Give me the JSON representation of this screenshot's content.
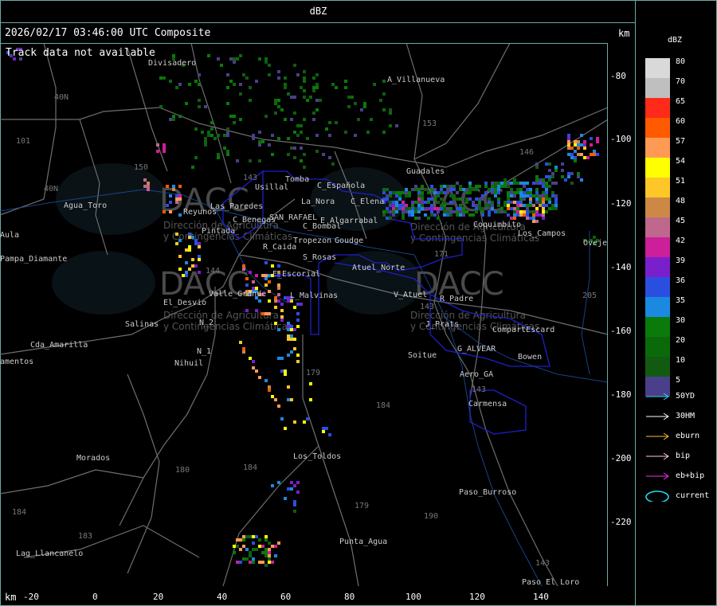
{
  "header": {
    "title": "dBZ"
  },
  "overlay": {
    "timestamp": "2026/02/17 03:46:00 UTC Composite",
    "track_status": "Track data not available",
    "unit_top": "km",
    "unit_bottom": "km"
  },
  "axes": {
    "y_ticks": [
      "-80",
      "-100",
      "-120",
      "-140",
      "-160",
      "-180",
      "-200",
      "-220"
    ],
    "x_ticks": [
      "-20",
      "0",
      "20",
      "40",
      "60",
      "80",
      "100",
      "120",
      "140"
    ]
  },
  "legend": {
    "title": "dBZ",
    "levels": [
      {
        "label": "80",
        "color": "#d9d9d9"
      },
      {
        "label": "70",
        "color": "#bfbfbf"
      },
      {
        "label": "65",
        "color": "#ff2a1a"
      },
      {
        "label": "60",
        "color": "#ff5a00"
      },
      {
        "label": "57",
        "color": "#ff9a55"
      },
      {
        "label": "54",
        "color": "#ffff00"
      },
      {
        "label": "51",
        "color": "#ffc628"
      },
      {
        "label": "48",
        "color": "#cc8844"
      },
      {
        "label": "45",
        "color": "#c0678d"
      },
      {
        "label": "42",
        "color": "#cc1f99"
      },
      {
        "label": "39",
        "color": "#7a1fcc"
      },
      {
        "label": "36",
        "color": "#2a4fe0"
      },
      {
        "label": "35",
        "color": "#1a8ae0"
      },
      {
        "label": "30",
        "color": "#0a7a0a"
      },
      {
        "label": "20",
        "color": "#0a6a0a"
      },
      {
        "label": "10",
        "color": "#125a12"
      },
      {
        "label": "5",
        "color": "#4a3f8a"
      }
    ],
    "tracks": [
      {
        "label": "50YD",
        "color": "#22ddee"
      },
      {
        "label": "30HM",
        "color": "#ffffff"
      },
      {
        "label": "eburn",
        "color": "#ffbb33"
      },
      {
        "label": "bip",
        "color": "#ffccdd"
      },
      {
        "label": "eb+bip",
        "color": "#ee33ee"
      },
      {
        "label": "current",
        "color": "#22ddee"
      }
    ]
  },
  "map": {
    "place_labels": [
      {
        "text": "Divisadero"
      },
      {
        "text": "A_Villanueva"
      },
      {
        "text": "Guadales"
      },
      {
        "text": "Usillal"
      },
      {
        "text": "Tomba"
      },
      {
        "text": "C_Española"
      },
      {
        "text": "La_Nora"
      },
      {
        "text": "C_Elena"
      },
      {
        "text": "Agua_Toro"
      },
      {
        "text": "Reyunos"
      },
      {
        "text": "Las_Paredes"
      },
      {
        "text": "C_Benegas"
      },
      {
        "text": "SAN_RAFAEL"
      },
      {
        "text": "E_Algarrabal"
      },
      {
        "text": "C_Bombal"
      },
      {
        "text": "Pintada"
      },
      {
        "text": "Tropezon"
      },
      {
        "text": "Goudge"
      },
      {
        "text": "Pampa_Diamante"
      },
      {
        "text": "R_Caida"
      },
      {
        "text": "S_Rosas"
      },
      {
        "text": "Atuel_Norte"
      },
      {
        "text": "Los_Campos"
      },
      {
        "text": "Ovejero"
      },
      {
        "text": "E_Escorial"
      },
      {
        "text": "Valle_Grande"
      },
      {
        "text": "L_Malvinas"
      },
      {
        "text": "V_Atuel"
      },
      {
        "text": "R_Padre"
      },
      {
        "text": "El_Desvio"
      },
      {
        "text": "Salinas"
      },
      {
        "text": "N_2"
      },
      {
        "text": "J_Prats"
      },
      {
        "text": "CompartEscard"
      },
      {
        "text": "Cda_Amarilla"
      },
      {
        "text": "N_1"
      },
      {
        "text": "Nihuil"
      },
      {
        "text": "G_ALVEAR"
      },
      {
        "text": "Soitue"
      },
      {
        "text": "Bowen"
      },
      {
        "text": "Aero_GA"
      },
      {
        "text": "Carmensa"
      },
      {
        "text": "Los_Toldos"
      },
      {
        "text": "Morados"
      },
      {
        "text": "Paso_Burroso"
      },
      {
        "text": "Punta_Agua"
      },
      {
        "text": "Paso_El_Loro"
      },
      {
        "text": "Lag_Llancanelo"
      },
      {
        "text": "Aula"
      },
      {
        "text": "amentos"
      },
      {
        "text": "Coquimbito"
      }
    ],
    "route_labels": [
      "40N",
      "40N",
      "101",
      "150",
      "143",
      "153",
      "146",
      "171",
      "144",
      "179",
      "184",
      "180",
      "184",
      "183",
      "184",
      "179",
      "190",
      "143",
      "205",
      "143",
      "143"
    ],
    "watermarks": [
      "DACC",
      "Dirección de Agricultura",
      "y Contingencias Climáticas"
    ]
  }
}
